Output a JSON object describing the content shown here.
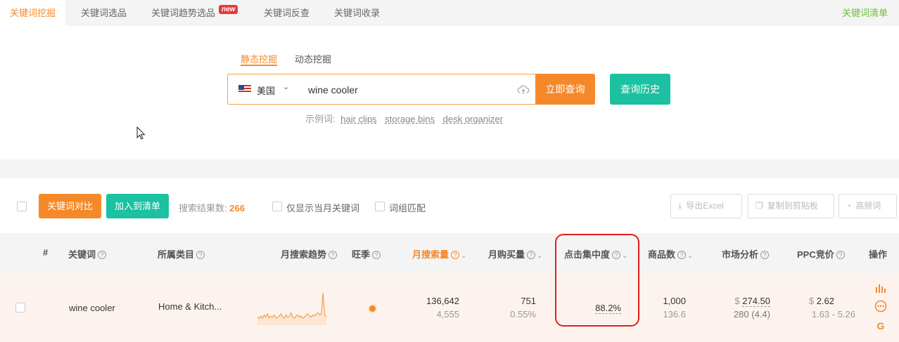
{
  "top_tabs": [
    "关键词挖掘",
    "关键词选品",
    "关键词趋势选品",
    "关键词反查",
    "关键词收录"
  ],
  "new_badge": "new",
  "keyword_list_link": "关键词清单",
  "mode_tabs": [
    "静态挖掘",
    "动态挖掘"
  ],
  "search": {
    "country": "美国",
    "value": "wine cooler",
    "query_button": "立即查询",
    "history_button": "查询历史",
    "examples_label": "示例词:",
    "examples": [
      "hair clips",
      "storage bins",
      "desk organizer"
    ]
  },
  "toolbar": {
    "compare_button": "关键词对比",
    "add_list_button": "加入到清单",
    "result_label": "搜索结果数:",
    "result_count": "266",
    "only_month_label": "仅显示当月关键词",
    "phrase_match_label": "词组匹配",
    "export_button": "导出Excel",
    "copy_button": "复制到剪贴板",
    "high_freq_button": "高频词"
  },
  "columns": [
    "#",
    "关键词",
    "所属类目",
    "月搜索趋势",
    "旺季",
    "月搜索量",
    "月购买量",
    "点击集中度",
    "商品数",
    "市场分析",
    "PPC竞价",
    "操作"
  ],
  "row": {
    "keyword": "wine cooler",
    "category": "Home & Kitch...",
    "monthly_search": "136,642",
    "monthly_search_sub": "4,555",
    "monthly_purchase": "751",
    "monthly_purchase_sub": "0.55%",
    "click_concentration": "88.2%",
    "products": "1,000",
    "products_sub": "136.6",
    "market_price": "274.50",
    "market_sub": "280 (4.4)",
    "ppc": "2.62",
    "ppc_range": "1.63 - 5.26",
    "currency": "$",
    "trend": [
      6,
      5,
      7,
      5,
      8,
      6,
      9,
      5,
      7,
      6,
      8,
      5,
      6,
      7,
      9,
      6,
      5,
      8,
      6,
      7,
      10,
      6,
      5,
      7,
      8,
      6,
      7,
      5,
      6,
      8,
      9,
      7,
      6,
      8,
      7,
      9,
      10,
      8,
      9,
      28,
      8,
      6
    ]
  },
  "colors": {
    "accent": "#f5892a",
    "green": "#1bc1a0",
    "highlight": "#e0201f"
  }
}
